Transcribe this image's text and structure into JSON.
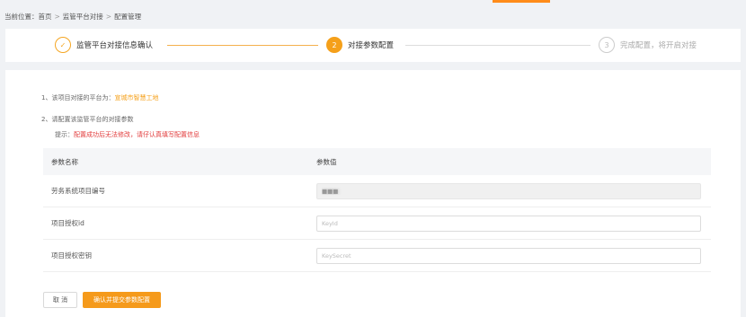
{
  "breadcrumb": {
    "prefix": "当前位置：",
    "items": [
      "首页",
      "监管平台对接",
      "配置管理"
    ],
    "separator": ">"
  },
  "steps": [
    {
      "index": "✓",
      "label": "监管平台对接信息确认",
      "state": "done"
    },
    {
      "index": "2",
      "label": "对接参数配置",
      "state": "active"
    },
    {
      "index": "3",
      "label": "完成配置，将开启对接",
      "state": "pending"
    }
  ],
  "info": {
    "line1_prefix": "1、该项目对接的平台为：",
    "platform_name": "宣城市智慧工地",
    "line2": "2、请配置该监管平台的对接参数",
    "tip_prefix": "提示：",
    "tip_warning": "配置成功后无法修改，请仔认真填写配置信息"
  },
  "table": {
    "headers": [
      "参数名称",
      "参数值"
    ],
    "rows": [
      {
        "name": "劳务系统项目编号",
        "value": "■■■",
        "placeholder": "",
        "disabled": true
      },
      {
        "name": "项目授权id",
        "value": "",
        "placeholder": "KeyId",
        "disabled": false
      },
      {
        "name": "项目授权密钥",
        "value": "",
        "placeholder": "KeySecret",
        "disabled": false
      }
    ]
  },
  "actions": {
    "cancel_label": "取 消",
    "confirm_label": "确认并提交参数配置"
  },
  "colors": {
    "accent": "#f5a01a",
    "warning": "#e23b3b"
  }
}
